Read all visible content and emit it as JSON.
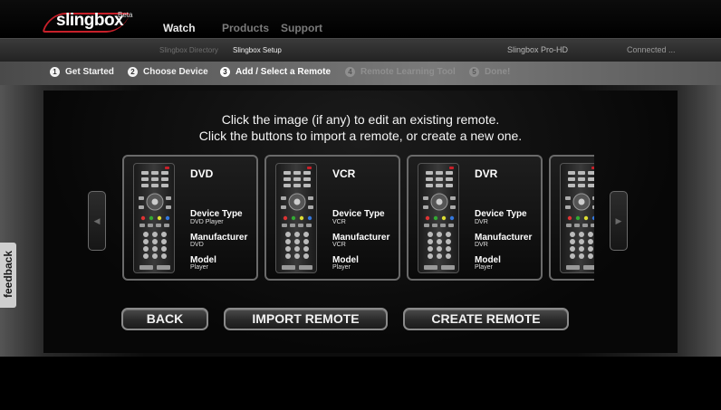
{
  "header": {
    "logo_text": "slingbox",
    "logo_badge": "Beta",
    "nav": [
      {
        "label": "Watch"
      },
      {
        "label": "Products"
      },
      {
        "label": "Support"
      }
    ]
  },
  "subnav": {
    "items": [
      {
        "label": "Slingbox Directory"
      },
      {
        "label": "Slingbox Setup"
      }
    ],
    "device_name": "Slingbox Pro-HD",
    "connection_status": "Connected ..."
  },
  "steps": [
    {
      "number": "1",
      "label": "Get Started"
    },
    {
      "number": "2",
      "label": "Choose Device"
    },
    {
      "number": "3",
      "label": "Add / Select a Remote"
    },
    {
      "number": "4",
      "label": "Remote Learning Tool"
    },
    {
      "number": "5",
      "label": "Done!"
    }
  ],
  "instructions": {
    "line1": "Click the image (if any) to edit an existing remote.",
    "line2": "Click the buttons to import a remote, or create a new one."
  },
  "remote_labels": {
    "device_type": "Device Type",
    "manufacturer": "Manufacturer",
    "model": "Model"
  },
  "remotes": [
    {
      "title": "DVD",
      "device_type": "DVD Player",
      "manufacturer": "DVD",
      "model": "Player"
    },
    {
      "title": "VCR",
      "device_type": "VCR",
      "manufacturer": "VCR",
      "model": "Player"
    },
    {
      "title": "DVR",
      "device_type": "DVR",
      "manufacturer": "DVR",
      "model": "Player"
    }
  ],
  "carousel": {
    "prev_icon": "arrow-left-icon",
    "next_icon": "arrow-right-icon"
  },
  "buttons": {
    "back": "BACK",
    "import": "IMPORT REMOTE",
    "create": "CREATE REMOTE"
  },
  "feedback": {
    "label": "feedback"
  },
  "colors": {
    "brand_red": "#c8202a",
    "background": "#000000",
    "button_border": "#8a8a8a"
  }
}
